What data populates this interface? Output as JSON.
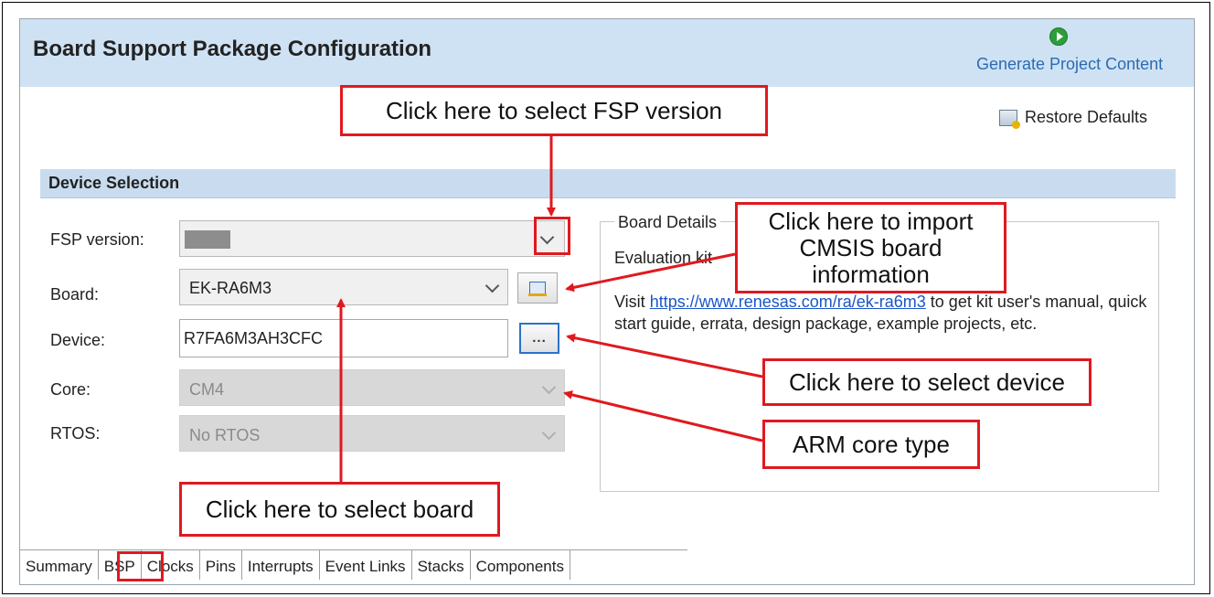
{
  "panel": {
    "title": "Board Support Package Configuration",
    "generate_label": "Generate Project Content",
    "restore_label": "Restore Defaults"
  },
  "device_selection": {
    "section_title": "Device Selection",
    "fields": {
      "fsp_version": {
        "label": "FSP version:",
        "value": ""
      },
      "board": {
        "label": "Board:",
        "value": "EK-RA6M3"
      },
      "device": {
        "label": "Device:",
        "value": "R7FA6M3AH3CFC",
        "browse_label": "..."
      },
      "core": {
        "label": "Core:",
        "value": "CM4"
      },
      "rtos": {
        "label": "RTOS:",
        "value": "No RTOS"
      }
    }
  },
  "board_details": {
    "title": "Board Details",
    "kit_line": "Evaluation kit",
    "visit_prefix": "Visit ",
    "link": "https://www.renesas.com/ra/ek-ra6m3",
    "visit_suffix": " to get kit user's manual, quick start guide, errata, design package, example projects, etc."
  },
  "callouts": {
    "fsp": "Click here to select FSP version",
    "import": "Click here to import CMSIS board information",
    "device": "Click here to select device",
    "core": "ARM core type",
    "board": "Click here to select board"
  },
  "tabs": [
    "Summary",
    "BSP",
    "Clocks",
    "Pins",
    "Interrupts",
    "Event Links",
    "Stacks",
    "Components"
  ],
  "colors": {
    "header_bg": "#cfe2f4",
    "annotation_red": "#e0191f",
    "link_blue": "#1a56c8"
  }
}
